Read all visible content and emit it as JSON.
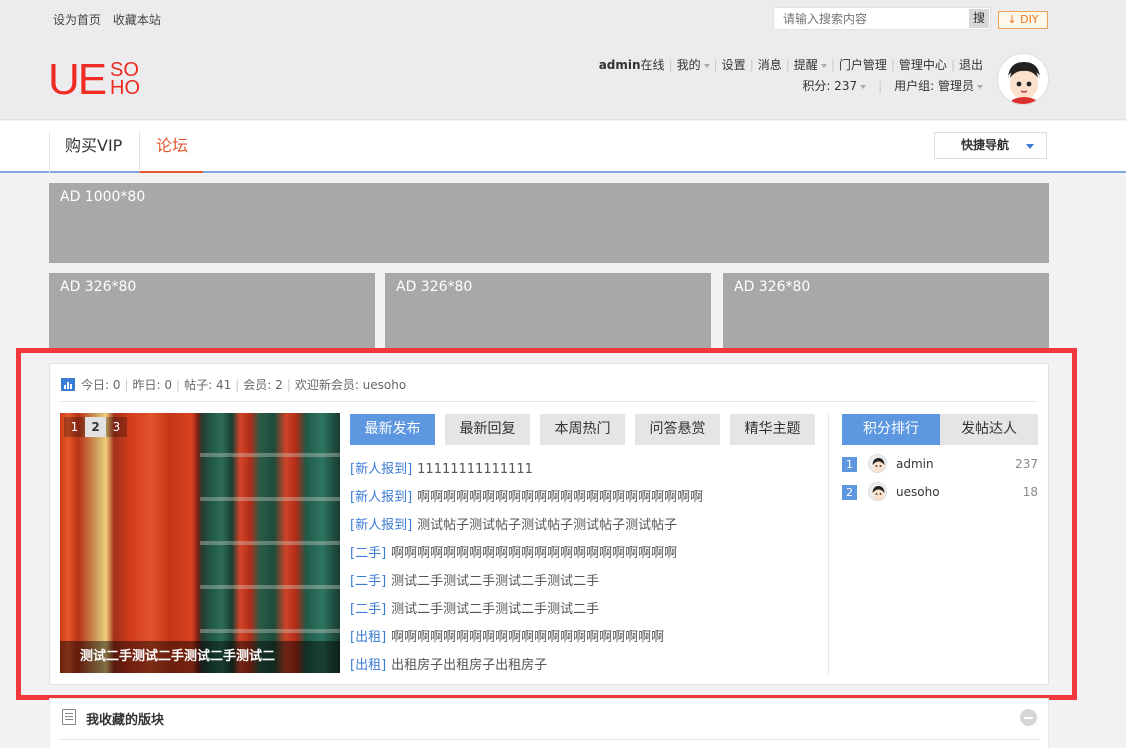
{
  "topbar": {
    "set_home": "设为首页",
    "bookmark": "收藏本站",
    "search_placeholder": "请输入搜索内容",
    "search_btn": "搜",
    "diy": "DIY"
  },
  "logo": {
    "ue": "UE",
    "so": "SO",
    "ho": "HO"
  },
  "user": {
    "name": "admin",
    "online": "在线",
    "mine": "我的",
    "settings": "设置",
    "messages": "消息",
    "remind": "提醒",
    "portal_admin": "门户管理",
    "admin_center": "管理中心",
    "logout": "退出",
    "points": "积分: 237",
    "group": "用户组: 管理员"
  },
  "nav": {
    "tabs": [
      "购买VIP",
      "论坛"
    ],
    "quick_nav": "快捷导航"
  },
  "ads": [
    "AD 1000*80",
    "AD 326*80",
    "AD 326*80",
    "AD 326*80"
  ],
  "stats": {
    "today": "今日: 0",
    "yesterday": "昨日: 0",
    "posts": "帖子: 41",
    "members": "会员: 2",
    "welcome": "欢迎新会员: uesoho"
  },
  "slideshow": {
    "pages": [
      "1",
      "2",
      "3"
    ],
    "active_page": "2",
    "caption": "测试二手测试二手测试二手测试二"
  },
  "thread_tabs": [
    "最新发布",
    "最新回复",
    "本周热门",
    "问答悬赏",
    "精华主题"
  ],
  "threads": [
    {
      "cat": "[新人报到]",
      "title": "11111111111111"
    },
    {
      "cat": "[新人报到]",
      "title": "啊啊啊啊啊啊啊啊啊啊啊啊啊啊啊啊啊啊啊啊啊啊"
    },
    {
      "cat": "[新人报到]",
      "title": "测试帖子测试帖子测试帖子测试帖子测试帖子"
    },
    {
      "cat": "[二手]",
      "title": "啊啊啊啊啊啊啊啊啊啊啊啊啊啊啊啊啊啊啊啊啊啊"
    },
    {
      "cat": "[二手]",
      "title": "测试二手测试二手测试二手测试二手"
    },
    {
      "cat": "[二手]",
      "title": "测试二手测试二手测试二手测试二手"
    },
    {
      "cat": "[出租]",
      "title": "啊啊啊啊啊啊啊啊啊啊啊啊啊啊啊啊啊啊啊啊啊"
    },
    {
      "cat": "[出租]",
      "title": "出租房子出租房子出租房子"
    }
  ],
  "rank_tabs": [
    "积分排行",
    "发帖达人"
  ],
  "ranking": [
    {
      "rank": "1",
      "name": "admin",
      "score": "237"
    },
    {
      "rank": "2",
      "name": "uesoho",
      "score": "18"
    }
  ],
  "favorites": {
    "title": "我收藏的版块"
  },
  "colors": {
    "accent": "#5d97e0",
    "brand": "#ee2c24",
    "highlight": "#f2383c"
  }
}
